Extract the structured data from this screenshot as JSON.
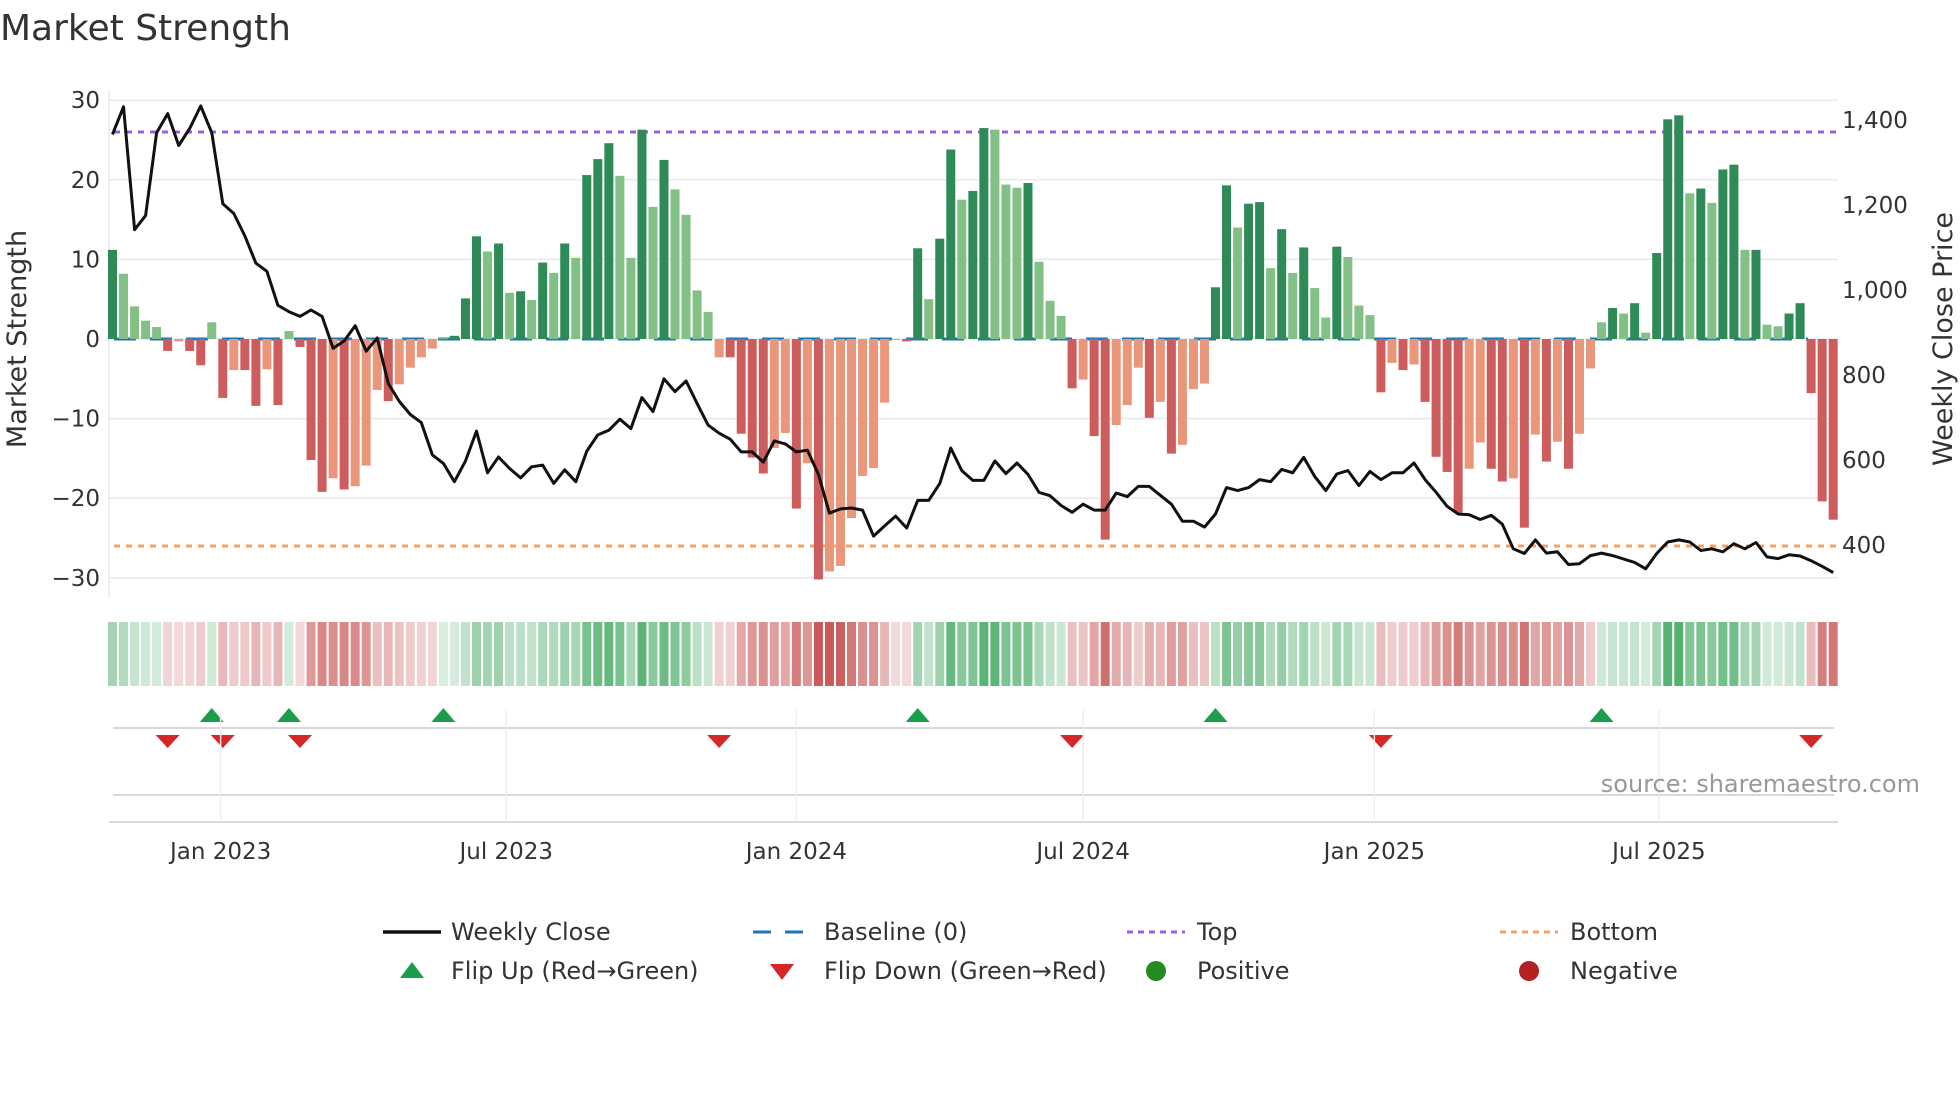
{
  "chart_data": {
    "type": "bar",
    "title": "Market Strength",
    "ylabel": "Market Strength",
    "y2label": "Weekly Close Price",
    "ylim": [
      -32,
      32
    ],
    "y2lim": [
      325,
      1480
    ],
    "yticks": [
      30,
      20,
      10,
      0,
      -10,
      -20,
      -30
    ],
    "yticklabels": [
      "30",
      "20",
      "10",
      "0",
      "−10",
      "−20",
      "−30"
    ],
    "y2ticks": [
      1400,
      1200,
      1000,
      800,
      600,
      400
    ],
    "y2ticklabels": [
      "1,400",
      "1,200",
      "1,000",
      "800",
      "600",
      "400"
    ],
    "x_unit": "week index",
    "xticks": [
      {
        "week": 10.8,
        "label": "Jan 2023"
      },
      {
        "week": 36.7,
        "label": "Jul 2023"
      },
      {
        "week": 63.0,
        "label": "Jan 2024"
      },
      {
        "week": 89.0,
        "label": "Jul 2024"
      },
      {
        "week": 115.4,
        "label": "Jan 2025"
      },
      {
        "week": 141.2,
        "label": "Jul 2025"
      }
    ],
    "top_level": 26,
    "bottom_level": -26,
    "baseline": 0,
    "strength": [
      11.2,
      8.2,
      4.1,
      2.3,
      1.5,
      -1.5,
      -0.3,
      -1.5,
      -3.3,
      2.1,
      -7.4,
      -3.9,
      -3.9,
      -8.4,
      -3.8,
      -8.3,
      1.0,
      -1.0,
      -15.2,
      -19.2,
      -17.5,
      -18.9,
      -18.5,
      -15.9,
      -6.4,
      -7.8,
      -5.7,
      -3.6,
      -2.3,
      -1.2,
      0.1,
      0.4,
      5.1,
      12.9,
      11.0,
      12.0,
      5.8,
      6.0,
      4.9,
      9.6,
      8.3,
      12.0,
      10.2,
      20.6,
      22.6,
      24.6,
      20.5,
      10.2,
      26.3,
      16.6,
      22.5,
      18.8,
      15.6,
      6.1,
      3.4,
      -2.3,
      -2.3,
      -11.9,
      -14.9,
      -16.9,
      -13.7,
      -11.8,
      -21.3,
      -15.6,
      -30.2,
      -29.2,
      -28.5,
      -22.5,
      -17.2,
      -16.2,
      -8.0,
      -0.1,
      -0.3,
      11.4,
      5.0,
      12.6,
      23.8,
      17.5,
      18.6,
      26.5,
      26.3,
      19.4,
      19.0,
      19.6,
      9.7,
      4.8,
      2.9,
      -6.2,
      -5.1,
      -12.2,
      -25.2,
      -10.8,
      -8.3,
      -3.6,
      -9.9,
      -7.9,
      -14.4,
      -13.3,
      -6.3,
      -5.6,
      6.5,
      19.3,
      14.0,
      17.0,
      17.2,
      8.9,
      13.8,
      8.3,
      11.5,
      6.4,
      2.7,
      11.6,
      10.3,
      4.2,
      3.0,
      -6.7,
      -3.0,
      -3.9,
      -3.2,
      -7.9,
      -14.8,
      -16.7,
      -21.8,
      -16.3,
      -13.0,
      -16.3,
      -17.9,
      -17.5,
      -23.7,
      -12.0,
      -15.4,
      -12.9,
      -16.3,
      -11.9,
      -3.7,
      2.1,
      3.9,
      3.2,
      4.5,
      0.8,
      10.8,
      27.6,
      28.1,
      18.3,
      18.9,
      17.1,
      21.3,
      21.9,
      11.2,
      11.2,
      1.8,
      1.6,
      3.2,
      4.5,
      -6.8,
      -20.4,
      -22.7
    ],
    "weekly_close": [
      1366,
      1431,
      1142,
      1175,
      1370,
      1415,
      1340,
      1380,
      1433,
      1370,
      1203,
      1180,
      1127,
      1063,
      1044,
      964,
      949,
      938,
      953,
      938,
      863,
      880,
      916,
      856,
      887,
      780,
      738,
      707,
      688,
      612,
      592,
      549,
      598,
      668,
      570,
      607,
      580,
      558,
      584,
      588,
      545,
      577,
      549,
      621,
      659,
      670,
      696,
      674,
      747,
      714,
      791,
      761,
      786,
      733,
      682,
      663,
      649,
      619,
      619,
      595,
      645,
      638,
      619,
      623,
      566,
      475,
      485,
      487,
      482,
      421,
      445,
      468,
      440,
      505,
      505,
      545,
      628,
      575,
      552,
      552,
      598,
      568,
      593,
      566,
      524,
      516,
      493,
      477,
      496,
      482,
      482,
      522,
      514,
      538,
      538,
      517,
      496,
      456,
      456,
      442,
      473,
      535,
      528,
      535,
      554,
      549,
      578,
      570,
      606,
      561,
      528,
      567,
      575,
      540,
      573,
      554,
      570,
      570,
      593,
      554,
      524,
      491,
      473,
      471,
      460,
      470,
      449,
      391,
      380,
      412,
      381,
      384,
      354,
      356,
      375,
      381,
      375,
      367,
      359,
      344,
      380,
      407,
      412,
      407,
      387,
      391,
      384,
      403,
      391,
      406,
      372,
      368,
      377,
      374,
      363,
      350,
      335
    ],
    "flip_up_weeks": [
      10,
      17,
      31,
      74,
      101,
      136
    ],
    "flip_down_weeks": [
      6,
      11,
      18,
      56,
      88,
      116,
      155
    ],
    "legend": {
      "placement": "bottom",
      "items": [
        {
          "label": "Weekly Close",
          "symbol": "line"
        },
        {
          "label": "Baseline (0)",
          "symbol": "dashed"
        },
        {
          "label": "Top",
          "symbol": "dotted-purple"
        },
        {
          "label": "Bottom",
          "symbol": "dotted-orange"
        },
        {
          "label": "Flip Up (Red→Green)",
          "symbol": "triangle-up"
        },
        {
          "label": "Flip Down (Green→Red)",
          "symbol": "triangle-down"
        },
        {
          "label": "Positive",
          "symbol": "circle-green"
        },
        {
          "label": "Negative",
          "symbol": "circle-red"
        }
      ]
    },
    "grid": true
  },
  "source": "source: sharemaestro.com",
  "colors": {
    "pos_strong": "#2e8b57",
    "pos_weak": "#82c085",
    "neg_strong": "#cd5c5c",
    "neg_weak": "#e9967a",
    "close": "#111111",
    "baseline": "#1f77b4",
    "top": "#9b5de5",
    "bottom": "#f4a261",
    "flip_up": "#1a9e4a",
    "flip_down": "#d62728",
    "positive": "#228b22",
    "negative": "#b22222"
  }
}
